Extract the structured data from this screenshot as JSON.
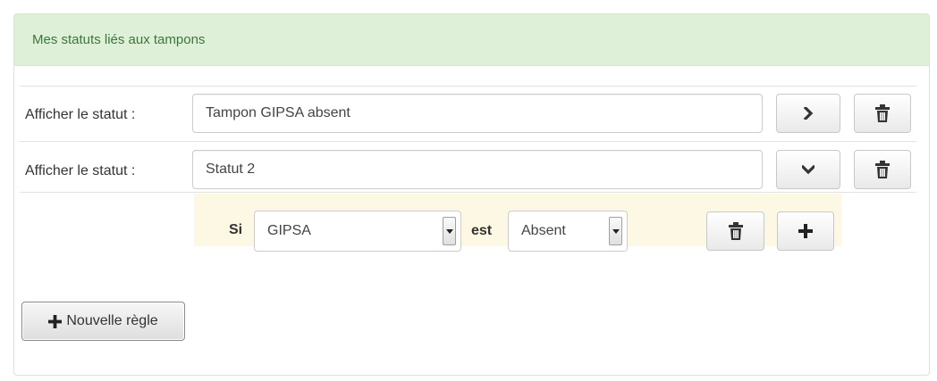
{
  "panel": {
    "title": "Mes statuts liés aux tampons"
  },
  "rows": [
    {
      "label": "Afficher le statut :",
      "value": "Tampon GIPSA absent",
      "toggle_icon": "chevron-right-icon",
      "delete_icon": "trash-icon"
    },
    {
      "label": "Afficher le statut :",
      "value": "Statut 2",
      "toggle_icon": "chevron-down-icon",
      "delete_icon": "trash-icon"
    }
  ],
  "rule": {
    "if_label": "Si",
    "subject_value": "GIPSA",
    "is_label": "est",
    "state_value": "Absent",
    "delete_icon": "trash-icon",
    "add_icon": "plus-icon"
  },
  "new_rule_button": {
    "label": "Nouvelle règle",
    "icon": "plus-icon"
  },
  "colors": {
    "heading_bg": "#dff0d8",
    "heading_text": "#3c763d",
    "rule_bg": "#fcf8e3",
    "border": "#d6e9c6"
  }
}
